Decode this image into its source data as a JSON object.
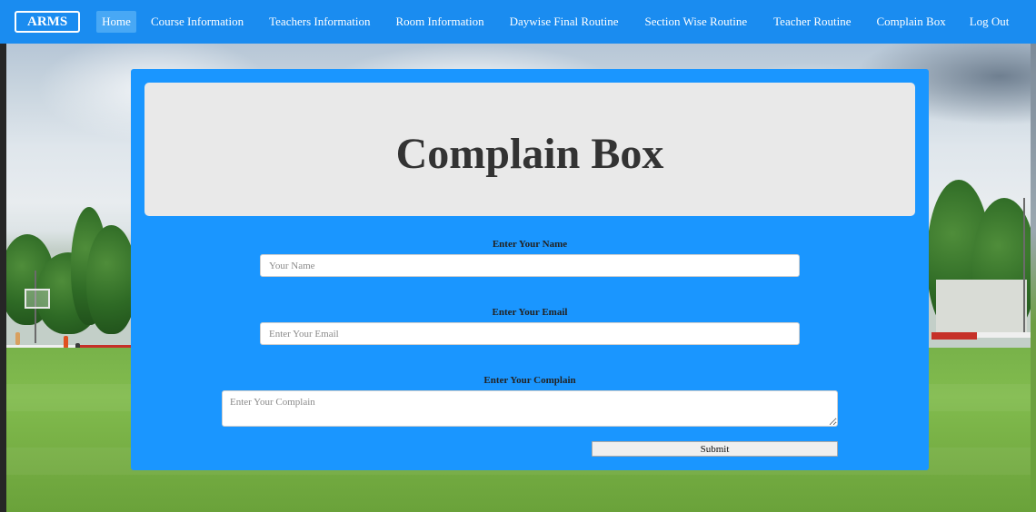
{
  "navbar": {
    "brand": "ARMS",
    "items": [
      {
        "label": "Home",
        "active": true
      },
      {
        "label": "Course Information",
        "active": false
      },
      {
        "label": "Teachers Information",
        "active": false
      },
      {
        "label": "Room Information",
        "active": false
      },
      {
        "label": "Daywise Final Routine",
        "active": false
      },
      {
        "label": "Section Wise Routine",
        "active": false
      },
      {
        "label": "Teacher Routine",
        "active": false
      },
      {
        "label": "Complain Box",
        "active": false
      },
      {
        "label": "Log Out",
        "active": false
      }
    ]
  },
  "header": {
    "title": "Complain Box"
  },
  "form": {
    "name": {
      "label": "Enter Your Name",
      "placeholder": "Your Name",
      "value": ""
    },
    "email": {
      "label": "Enter Your Email",
      "placeholder": "Enter Your Email",
      "value": ""
    },
    "complain": {
      "label": "Enter Your Complain",
      "placeholder": "Enter Your Complain",
      "value": ""
    },
    "submit_label": "Submit"
  },
  "colors": {
    "navbar": "#1a8cf0",
    "panel": "#1a96ff",
    "jumbotron": "#e9e9e9",
    "title_text": "#333333"
  }
}
